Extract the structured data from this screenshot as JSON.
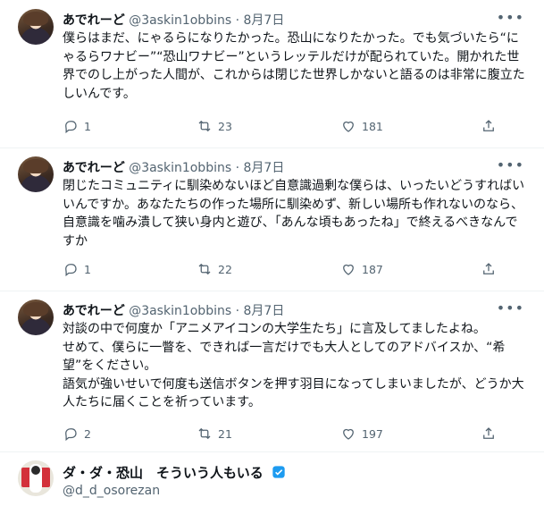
{
  "tweets": [
    {
      "name": "あでれーど",
      "handle": "@3askin1obbins",
      "sep": "·",
      "date": "8月7日",
      "text": "僕らはまだ、にゃるらになりたかった。恐山になりたかった。でも気づいたら“にゃるらワナビー”“恐山ワナビー”というレッテルだけが配られていた。開かれた世界でのし上がった人間が、これからは閉じた世界しかないと語るのは非常に腹立たしいんです。",
      "replies": "1",
      "retweets": "23",
      "likes": "181"
    },
    {
      "name": "あでれーど",
      "handle": "@3askin1obbins",
      "sep": "·",
      "date": "8月7日",
      "text": "閉じたコミュニティに馴染めないほど自意識過剰な僕らは、いったいどうすればいいんですか。あなたたちの作った場所に馴染めず、新しい場所も作れないのなら、自意識を噛み潰して狭い身内と遊び、「あんな頃もあったね」で終えるべきなんですか",
      "replies": "1",
      "retweets": "22",
      "likes": "187"
    },
    {
      "name": "あでれーど",
      "handle": "@3askin1obbins",
      "sep": "·",
      "date": "8月7日",
      "text": "対談の中で何度か「アニメアイコンの大学生たち」に言及してましたよね。\nせめて、僕らに一瞥を、できれば一言だけでも大人としてのアドバイスか、“希望”をください。\n語気が強いせいで何度も送信ボタンを押す羽目になってしまいましたが、どうか大人たちに届くことを祈っています。",
      "replies": "2",
      "retweets": "21",
      "likes": "197"
    }
  ],
  "last_tweet": {
    "name": "ダ・ダ・恐山　そういう人もいる",
    "handle": "@d_d_osorezan"
  },
  "icons": {
    "more": "more-horizontal-icon",
    "reply": "reply-icon",
    "retweet": "retweet-icon",
    "like": "heart-icon",
    "verified": "verified-badge-icon"
  },
  "colors": {
    "secondary_text": "#536471",
    "verified": "#1d9bf0"
  }
}
